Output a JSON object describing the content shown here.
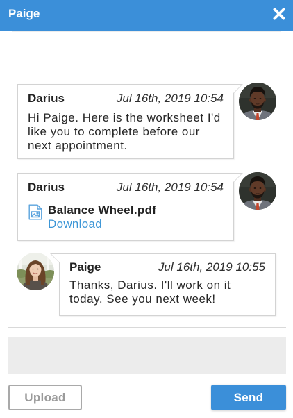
{
  "header": {
    "title": "Paige",
    "close_icon": "close-icon"
  },
  "messages": [
    {
      "sender": "Darius",
      "timestamp": "Jul 16th, 2019 10:54",
      "text": "Hi Paige. Here is the worksheet I'd like you to complete before our next appointment."
    },
    {
      "sender": "Darius",
      "timestamp": "Jul 16th, 2019 10:54",
      "attachment": {
        "icon": "image-file-icon",
        "filename": "Balance Wheel.pdf",
        "link_label": "Download"
      }
    },
    {
      "sender": "Paige",
      "timestamp": "Jul 16th, 2019 10:55",
      "text": "Thanks, Darius. I'll work on it today. See you next week!"
    }
  ],
  "composer": {
    "value": ""
  },
  "actions": {
    "upload_label": "Upload",
    "send_label": "Send"
  },
  "colors": {
    "primary": "#3b8fd9",
    "bubble_border": "#d3d3d3",
    "composer_bg": "#ececec",
    "link": "#3b95d6"
  }
}
